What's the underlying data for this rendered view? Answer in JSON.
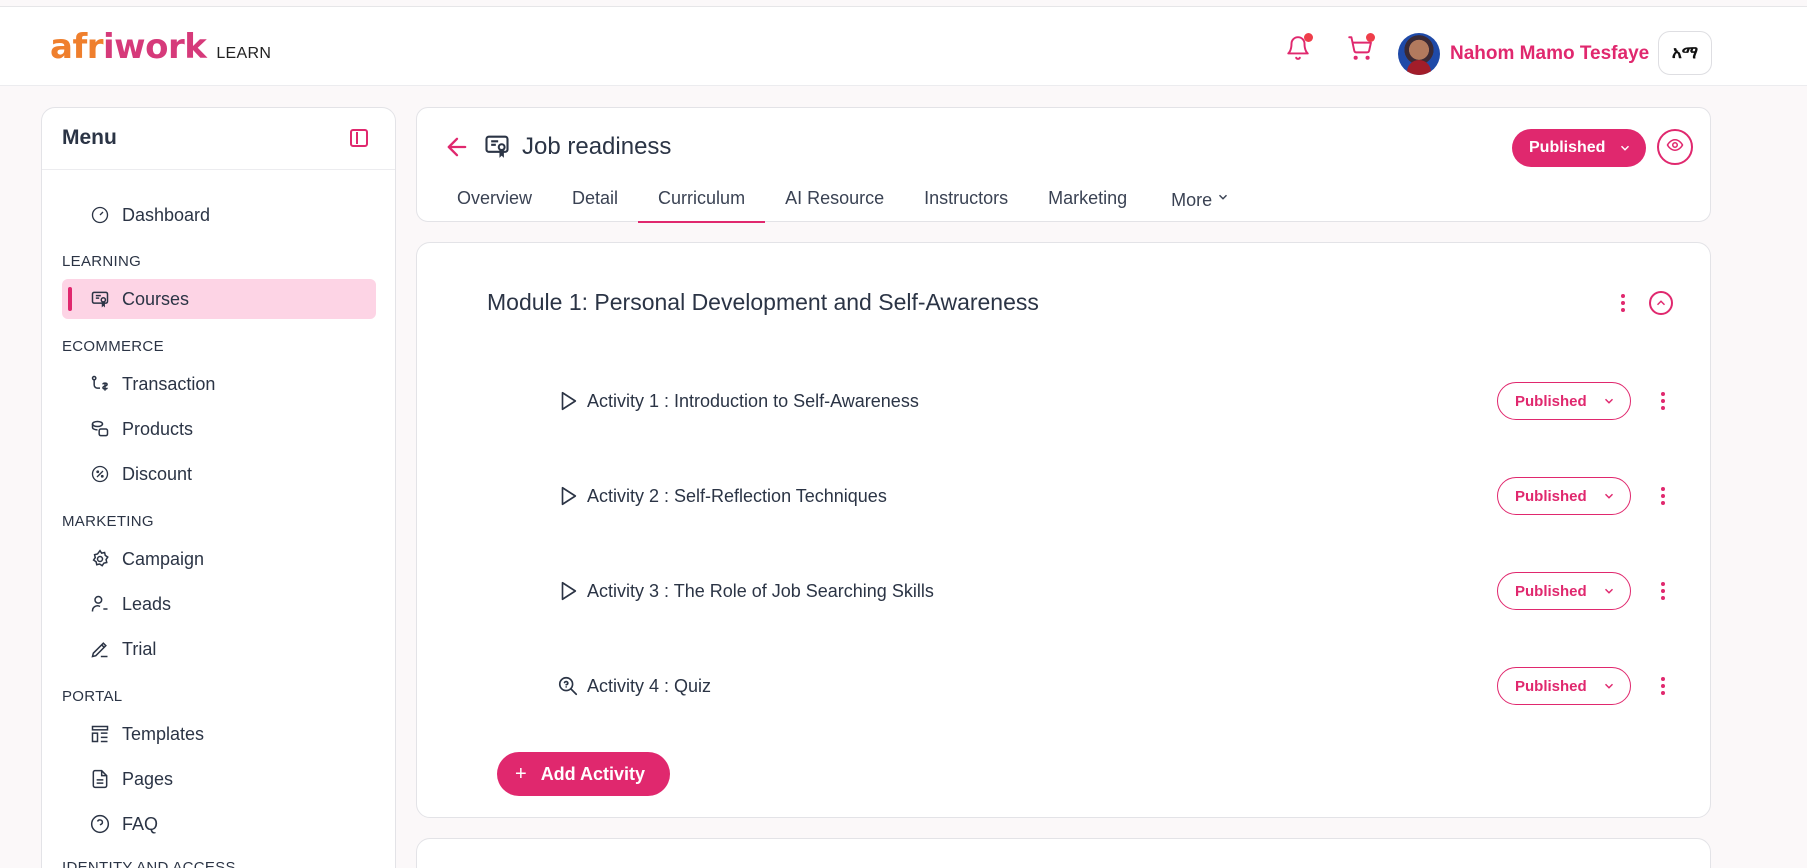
{
  "header": {
    "logo_part1": "afr",
    "logo_part2": "iwork",
    "logo_suffix": "LEARN",
    "user_name": "Nahom Mamo Tesfaye",
    "language_label": "አማ",
    "notifications_icon": "bell-icon",
    "cart_icon": "cart-icon"
  },
  "sidebar": {
    "title": "Menu",
    "dashboard": "Dashboard",
    "sections": {
      "learning": "LEARNING",
      "ecommerce": "ECOMMERCE",
      "marketing": "MARKETING",
      "portal": "PORTAL",
      "identity": "IDENTITY AND ACCESS"
    },
    "items": {
      "courses": "Courses",
      "transaction": "Transaction",
      "products": "Products",
      "discount": "Discount",
      "campaign": "Campaign",
      "leads": "Leads",
      "trial": "Trial",
      "templates": "Templates",
      "pages": "Pages",
      "faq": "FAQ"
    }
  },
  "course": {
    "title": "Job readiness",
    "status": "Published",
    "tabs": [
      "Overview",
      "Detail",
      "Curriculum",
      "AI Resource",
      "Instructors",
      "Marketing",
      "More"
    ],
    "active_tab": "Curriculum"
  },
  "module": {
    "title": "Module 1: Personal Development and Self-Awareness",
    "activities": [
      {
        "label": "Activity 1 :  Introduction to Self-Awareness",
        "type": "video",
        "status": "Published"
      },
      {
        "label": "Activity 2 :  Self-Reflection Techniques",
        "type": "video",
        "status": "Published"
      },
      {
        "label": "Activity 3 :  The Role of Job Searching Skills",
        "type": "video",
        "status": "Published"
      },
      {
        "label": "Activity 4 :  Quiz",
        "type": "quiz",
        "status": "Published"
      }
    ],
    "add_activity_label": "Add Activity"
  },
  "colors": {
    "accent": "#e0286e",
    "active_bg": "#fdd4e5",
    "logo_orange": "#ef7f2d"
  }
}
